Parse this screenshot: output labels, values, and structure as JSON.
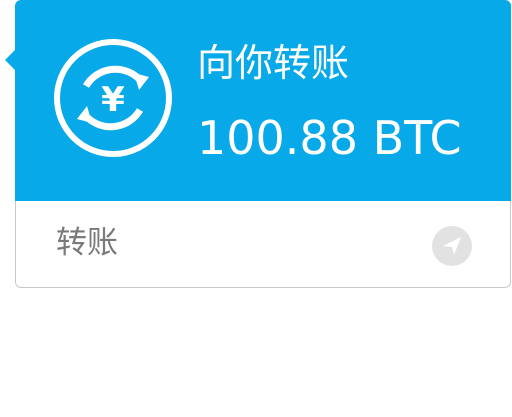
{
  "transfer": {
    "title": "向你转账",
    "amount": "100.88 BTC",
    "footer_label": "转账",
    "currency_symbol": "¥",
    "icons": {
      "coin": "yuan-exchange-icon",
      "action": "send-arrow-icon"
    },
    "colors": {
      "header_bg": "#08a9e8",
      "text_on_header": "#ffffff",
      "footer_text": "#7a7a7a",
      "action_icon_bg": "#e2e2e2"
    }
  }
}
